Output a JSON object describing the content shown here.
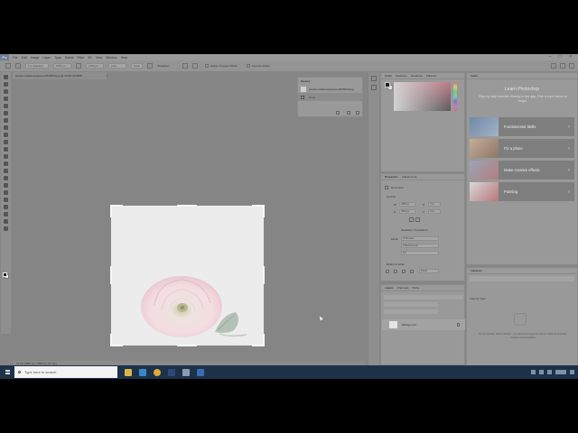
{
  "menubar": {
    "app_icon": "Ps",
    "items": [
      "File",
      "Edit",
      "Image",
      "Layer",
      "Type",
      "Select",
      "Filter",
      "3D",
      "View",
      "Window",
      "Help"
    ],
    "window_controls": [
      "minimize-icon",
      "maximize-icon",
      "close-icon"
    ]
  },
  "optionsbar": {
    "ratio": "1:1 (Square)",
    "width_value": "1080 px",
    "height_value": "1080 px",
    "resolution_value": "px/in",
    "clear_label": "Clear",
    "straighten_label": "Straighten",
    "delete_cropped_label": "Delete Cropped Pixels",
    "content_aware_label": "Content-Aware"
  },
  "document": {
    "tab_title": "pexels-natalia-sergeeva-2525830.jpg @ 12.5% (RGB/8)",
    "close_glyph": "×",
    "status": "12.5%    2880 px x 3854 px (72 ppi)"
  },
  "history": {
    "title": "History",
    "items": [
      {
        "label": "pexels-natalia-sergeeva-2525830.jpg",
        "selected": false
      },
      {
        "label": "Crop",
        "selected": true
      }
    ]
  },
  "color_panel": {
    "tabs": [
      "Color",
      "Swatches",
      "Gradients",
      "Patterns"
    ]
  },
  "properties": {
    "tabs": [
      "Properties",
      "Adjustments"
    ],
    "type_label": "Document",
    "canvas_section": "Canvas",
    "width_label": "W",
    "width_value": "2880 px",
    "x_label": "X",
    "x_value": "0 px",
    "height_label": "H",
    "height_value": "3854 px",
    "y_label": "Y",
    "y_value": "0 px",
    "resolution_label": "Resolution: 72 pixels/inch",
    "mode_label": "Mode",
    "mode_value": "RGB Color",
    "depth_value": "8 Bits/Channel",
    "fill_value": "Fill",
    "rulers_section": "Rulers & Grids",
    "pixels_value": "Pixels"
  },
  "layers": {
    "tabs": [
      "Layers",
      "Channels",
      "Paths"
    ],
    "layer_name": "Background"
  },
  "learn": {
    "tab": "Learn",
    "title": "Learn Photoshop",
    "description": "Step-by-step tutorials directly in the app. Pick a topic below to begin.",
    "cards": [
      {
        "label": "Fundamental Skills",
        "color": "#6f8aa8"
      },
      {
        "label": "Fix a photo",
        "color": "#a88f79"
      },
      {
        "label": "Make creative effects",
        "color": "#8a93a8"
      },
      {
        "label": "Painting",
        "color": "#b8777a"
      }
    ]
  },
  "libraries": {
    "tab": "Libraries",
    "view_by": "View by Type",
    "empty_text": "To use Creative Cloud Libraries, you need to be logged in with an Adobe ID and have Creative Cloud installed"
  },
  "taskbar": {
    "search_placeholder": "Type here to search",
    "apps": [
      "file-explorer-icon",
      "edge-icon",
      "chrome-icon",
      "photoshop-icon",
      "store-icon",
      "word-icon"
    ]
  }
}
